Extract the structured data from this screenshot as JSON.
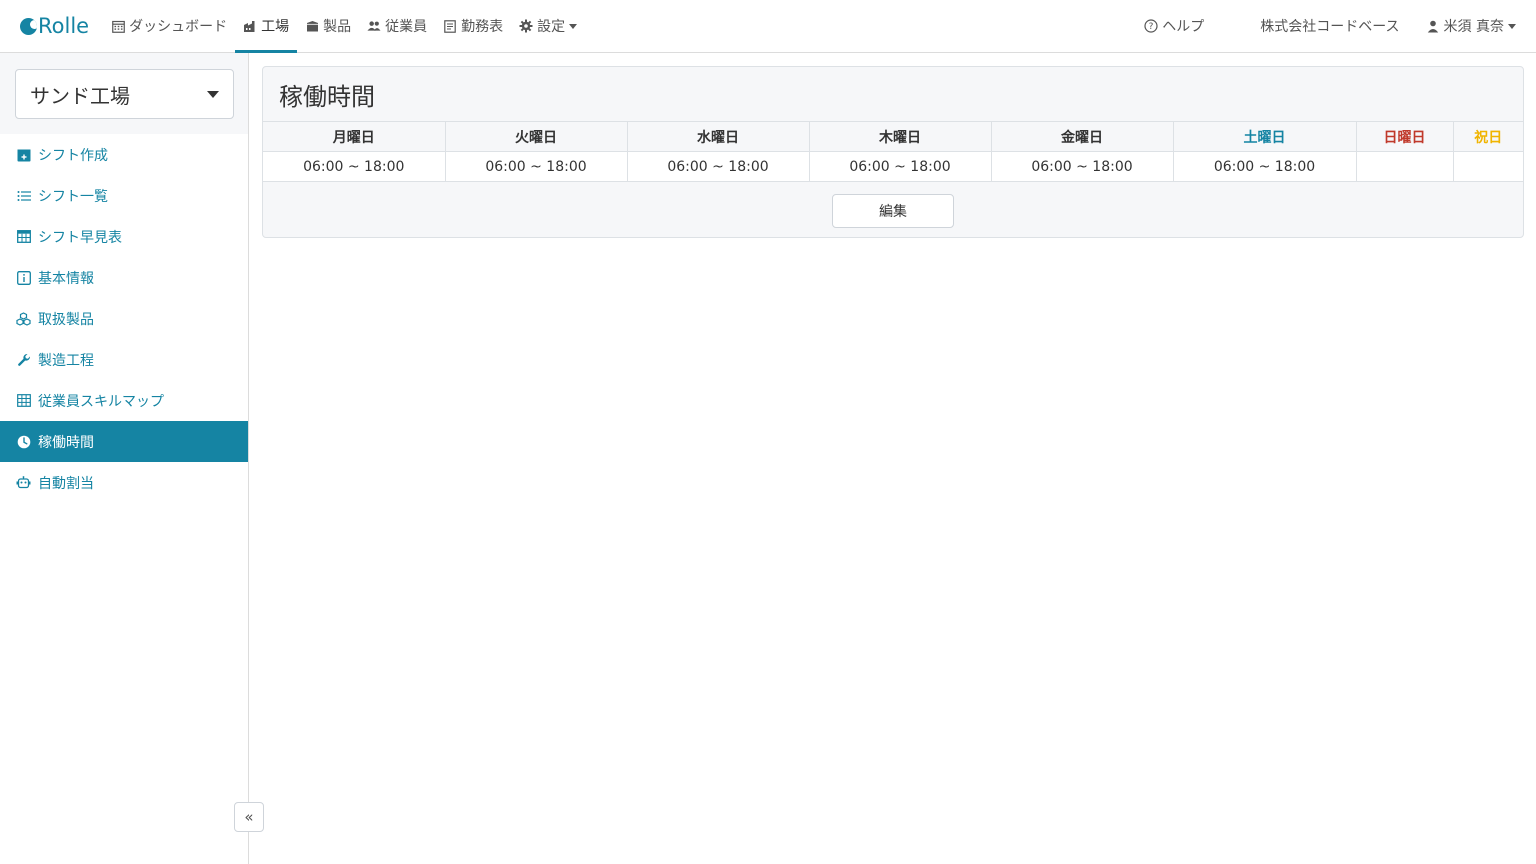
{
  "brand": {
    "name": "Rolle",
    "color": "#1584a3"
  },
  "nav": {
    "items": [
      {
        "label": "ダッシュボード",
        "icon": "calendar-icon"
      },
      {
        "label": "工場",
        "icon": "factory-icon",
        "active": true
      },
      {
        "label": "製品",
        "icon": "box-icon"
      },
      {
        "label": "従業員",
        "icon": "people-icon"
      },
      {
        "label": "勤務表",
        "icon": "document-icon"
      },
      {
        "label": "設定",
        "icon": "gear-icon",
        "dropdown": true
      }
    ],
    "help": "ヘルプ",
    "company": "株式会社コードベース",
    "user": "米須 真奈"
  },
  "sidebar": {
    "factory": "サンド工場",
    "items": [
      {
        "label": "シフト作成",
        "icon": "calendar-plus-icon"
      },
      {
        "label": "シフト一覧",
        "icon": "list-icon"
      },
      {
        "label": "シフト早見表",
        "icon": "table-icon"
      },
      {
        "label": "基本情報",
        "icon": "info-icon"
      },
      {
        "label": "取扱製品",
        "icon": "boxes-icon"
      },
      {
        "label": "製造工程",
        "icon": "wrench-icon"
      },
      {
        "label": "従業員スキルマップ",
        "icon": "grid-icon"
      },
      {
        "label": "稼働時間",
        "icon": "clock-icon",
        "active": true
      },
      {
        "label": "自動割当",
        "icon": "robot-icon"
      }
    ],
    "collapse": "«"
  },
  "main": {
    "title": "稼働時間",
    "days": [
      {
        "label": "月曜日",
        "hours": "06:00 ~ 18:00",
        "color": "#333333"
      },
      {
        "label": "火曜日",
        "hours": "06:00 ~ 18:00",
        "color": "#333333"
      },
      {
        "label": "水曜日",
        "hours": "06:00 ~ 18:00",
        "color": "#333333"
      },
      {
        "label": "木曜日",
        "hours": "06:00 ~ 18:00",
        "color": "#333333"
      },
      {
        "label": "金曜日",
        "hours": "06:00 ~ 18:00",
        "color": "#333333"
      },
      {
        "label": "土曜日",
        "hours": "06:00 ~ 18:00",
        "color": "#1584a3"
      },
      {
        "label": "日曜日",
        "hours": "",
        "color": "#c0392b"
      },
      {
        "label": "祝日",
        "hours": "",
        "color": "#f0b400"
      }
    ],
    "edit_label": "編集"
  }
}
